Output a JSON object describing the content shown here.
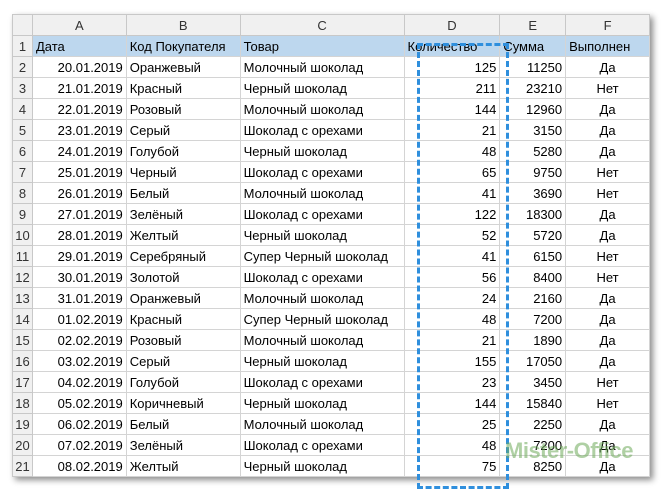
{
  "columns": [
    "A",
    "B",
    "C",
    "D",
    "E",
    "F"
  ],
  "headers": [
    "Дата",
    "Код Покупателя",
    "Товар",
    "Количество",
    "Сумма",
    "Выполнен"
  ],
  "rows": [
    [
      "20.01.2019",
      "Оранжевый",
      "Молочный шоколад",
      "125",
      "11250",
      "Да"
    ],
    [
      "21.01.2019",
      "Красный",
      "Черный шоколад",
      "211",
      "23210",
      "Нет"
    ],
    [
      "22.01.2019",
      "Розовый",
      "Молочный шоколад",
      "144",
      "12960",
      "Да"
    ],
    [
      "23.01.2019",
      "Серый",
      "Шоколад с орехами",
      "21",
      "3150",
      "Да"
    ],
    [
      "24.01.2019",
      "Голубой",
      "Черный шоколад",
      "48",
      "5280",
      "Да"
    ],
    [
      "25.01.2019",
      "Черный",
      "Шоколад с орехами",
      "65",
      "9750",
      "Нет"
    ],
    [
      "26.01.2019",
      "Белый",
      "Молочный шоколад",
      "41",
      "3690",
      "Нет"
    ],
    [
      "27.01.2019",
      "Зелёный",
      "Шоколад с орехами",
      "122",
      "18300",
      "Да"
    ],
    [
      "28.01.2019",
      "Желтый",
      "Черный шоколад",
      "52",
      "5720",
      "Да"
    ],
    [
      "29.01.2019",
      "Серебряный",
      "Супер Черный шоколад",
      "41",
      "6150",
      "Нет"
    ],
    [
      "30.01.2019",
      "Золотой",
      "Шоколад с орехами",
      "56",
      "8400",
      "Нет"
    ],
    [
      "31.01.2019",
      "Оранжевый",
      "Молочный шоколад",
      "24",
      "2160",
      "Да"
    ],
    [
      "01.02.2019",
      "Красный",
      "Супер Черный шоколад",
      "48",
      "7200",
      "Да"
    ],
    [
      "02.02.2019",
      "Розовый",
      "Молочный шоколад",
      "21",
      "1890",
      "Да"
    ],
    [
      "03.02.2019",
      "Серый",
      "Черный шоколад",
      "155",
      "17050",
      "Да"
    ],
    [
      "04.02.2019",
      "Голубой",
      "Шоколад с орехами",
      "23",
      "3450",
      "Нет"
    ],
    [
      "05.02.2019",
      "Коричневый",
      "Черный шоколад",
      "144",
      "15840",
      "Нет"
    ],
    [
      "06.02.2019",
      "Белый",
      "Молочный шоколад",
      "25",
      "2250",
      "Да"
    ],
    [
      "07.02.2019",
      "Зелёный",
      "Шоколад с орехами",
      "48",
      "7200",
      "Да"
    ],
    [
      "08.02.2019",
      "Желтый",
      "Черный шоколад",
      "75",
      "8250",
      "Да"
    ]
  ],
  "selection": {
    "column": "D",
    "color": "#2f8fdd"
  },
  "header_fill": "#bdd7ee",
  "watermark": "Mister-Office"
}
